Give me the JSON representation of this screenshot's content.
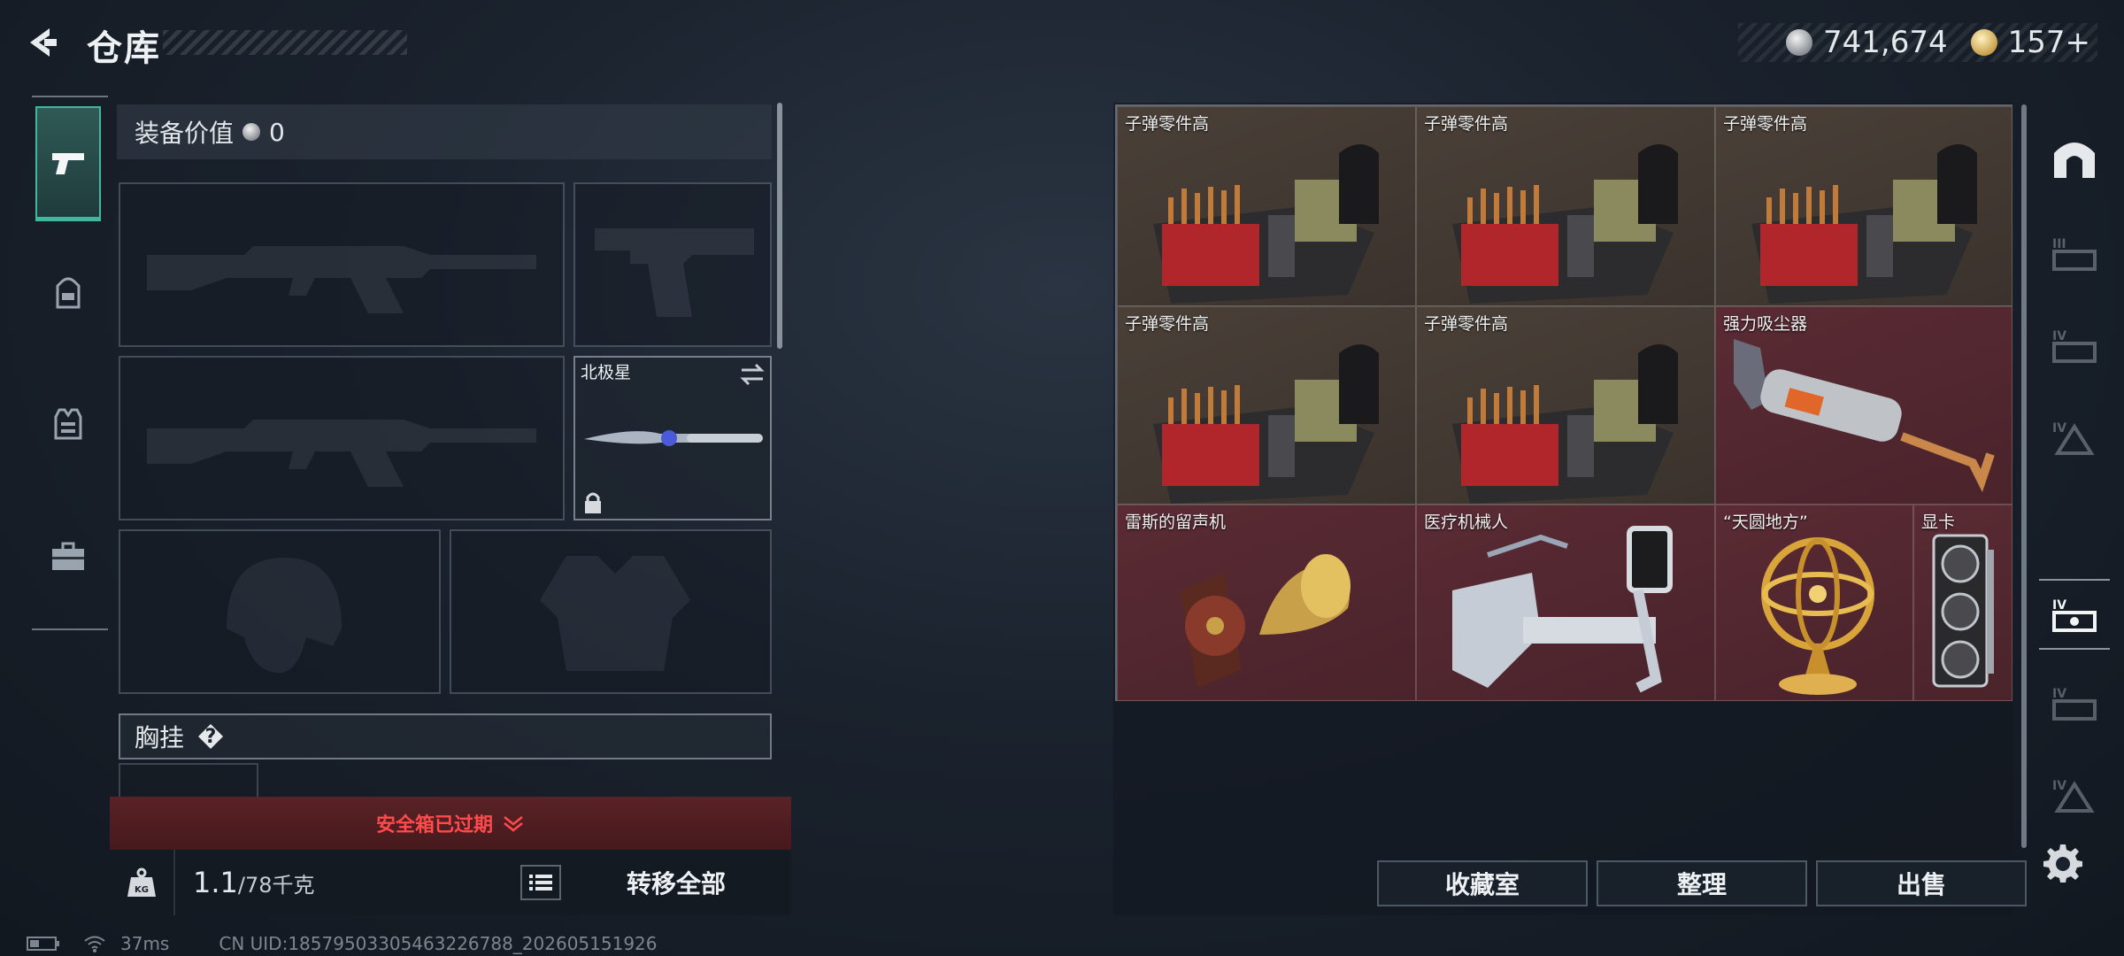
{
  "header": {
    "title": "仓库",
    "silver_amount": "741,674",
    "gold_amount": "157+",
    "icons": [
      "back-arrow-icon",
      "silver-coin-icon",
      "gold-coin-icon"
    ]
  },
  "left_nav": {
    "items": [
      {
        "name": "weapon",
        "icon": "pistol-icon",
        "active": true
      },
      {
        "name": "backpack",
        "icon": "backpack-icon",
        "active": false
      },
      {
        "name": "vest",
        "icon": "vest-icon",
        "active": false
      },
      {
        "name": "case",
        "icon": "briefcase-icon",
        "active": false
      }
    ]
  },
  "equipment": {
    "value_label": "装备价值",
    "value_amount": "0",
    "melee_name": "北极星",
    "chest_label": "胸挂",
    "chest_help": "?",
    "safe_box_status": "安全箱已过期",
    "weight_current": "1.1",
    "weight_max": "/78千克",
    "transfer_all": "转移全部"
  },
  "storage": {
    "items": [
      {
        "name": "子弹零件高",
        "kind": "ammo-parts",
        "color": "brown"
      },
      {
        "name": "子弹零件高",
        "kind": "ammo-parts",
        "color": "brown"
      },
      {
        "name": "子弹零件高",
        "kind": "ammo-parts",
        "color": "brown"
      },
      {
        "name": "子弹零件高",
        "kind": "ammo-parts",
        "color": "brown"
      },
      {
        "name": "子弹零件高",
        "kind": "ammo-parts",
        "color": "brown"
      },
      {
        "name": "强力吸尘器",
        "kind": "vacuum",
        "color": "red"
      },
      {
        "name": "雷斯的留声机",
        "kind": "gramophone",
        "color": "red"
      },
      {
        "name": "医疗机械人",
        "kind": "medical-robot",
        "color": "red"
      },
      {
        "name": "“天圆地方”",
        "kind": "armillary-sphere",
        "color": "red"
      },
      {
        "name": "显卡",
        "kind": "graphics-card",
        "color": "red"
      }
    ],
    "buttons": {
      "collection": "收藏室",
      "sort": "整理",
      "sell": "出售"
    }
  },
  "right_rail": {
    "items": [
      "arch-icon",
      "tier-3-icon",
      "tier-4-icon",
      "tier-4-icon",
      "tier-4-icon",
      "tier-4-icon",
      "tier-4-icon"
    ]
  },
  "status": {
    "ping": "37ms",
    "uid": "CN UID:18579503305463226788_202605151926"
  },
  "colors": {
    "accent": "#3fb89e",
    "warning": "#ff4b4b",
    "rarity_brown": "#4a4038",
    "rarity_red": "#5a2b34"
  }
}
